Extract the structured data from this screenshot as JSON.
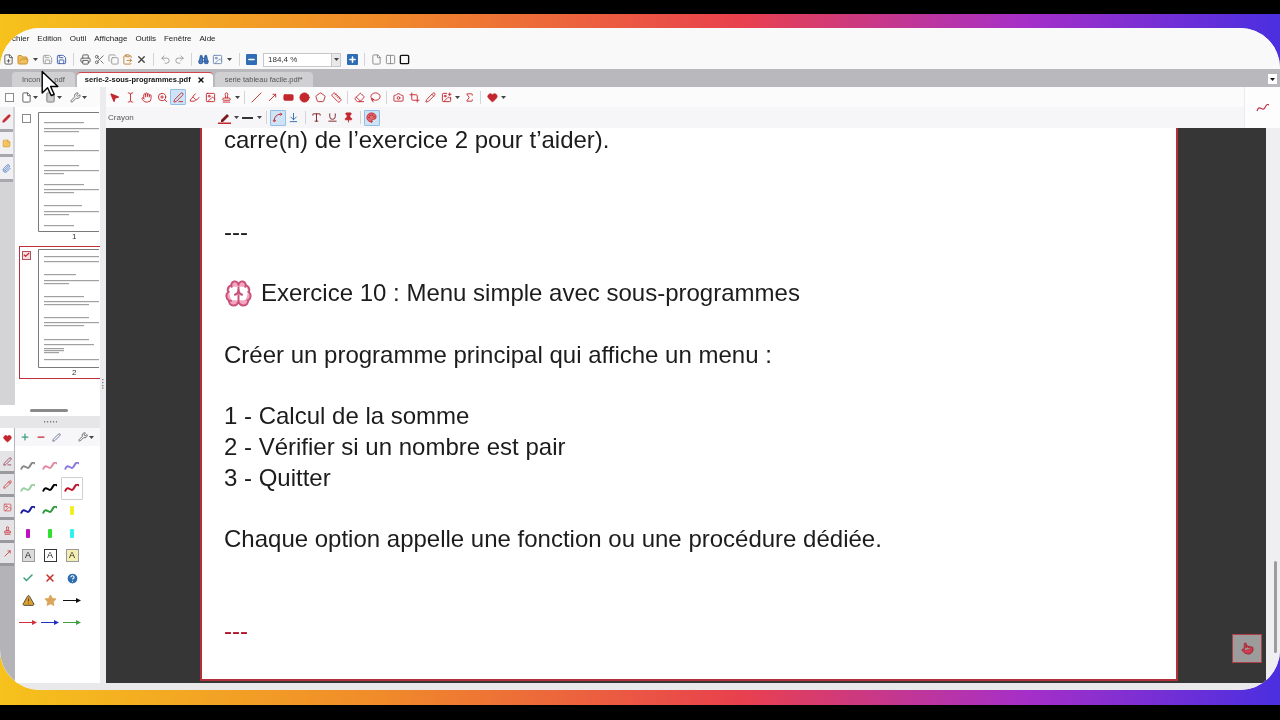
{
  "menu_bar": {
    "items": [
      "chier",
      "Edition",
      "Outil",
      "Affichage",
      "Outils",
      "Fenêtre",
      "Aide"
    ]
  },
  "toolbar": {
    "zoom_field": {
      "value": "184,4 %"
    }
  },
  "tabs": [
    {
      "label": "Incon",
      "label_tail": "pdf",
      "selected": false
    },
    {
      "label": "serie-2-sous-programmes.pdf",
      "selected": true
    },
    {
      "label": "serie tableau facile.pdf*",
      "selected": false
    }
  ],
  "thumbnails_pane": {
    "select_all_checked": false,
    "pages": [
      {
        "label": "1",
        "checked": false,
        "selected": false
      },
      {
        "label": "2",
        "checked": true,
        "selected": true
      }
    ]
  },
  "annotation_toolbar": {
    "tools": [
      {
        "selected": false
      },
      {
        "selected": false
      },
      {
        "selected": false
      },
      {
        "selected": false
      },
      {
        "selected": true
      },
      {
        "selected": false
      },
      {
        "selected": false
      },
      {
        "selected": false
      },
      {
        "selected": false
      },
      {
        "selected": false
      },
      {
        "selected": false
      },
      {
        "selected": false
      },
      {
        "selected": false
      },
      {
        "selected": false
      },
      {
        "selected": false
      },
      {
        "selected": false
      },
      {
        "selected": false
      },
      {
        "selected": false
      },
      {
        "selected": false
      },
      {
        "selected": false
      },
      {
        "selected": false
      },
      {
        "selected": false
      }
    ]
  },
  "property_bar": {
    "label": "Crayon",
    "tools": [
      {
        "selected": false
      },
      {
        "selected": false
      },
      {
        "selected": true
      },
      {
        "selected": false
      },
      {
        "selected": false
      },
      {
        "selected": false
      },
      {
        "selected": false
      },
      {
        "selected": true
      }
    ]
  },
  "comment_styles_pane": {
    "tabs": [
      {
        "selected": true
      },
      {
        "selected": false
      },
      {
        "selected": false
      },
      {
        "selected": false
      },
      {
        "selected": false
      },
      {
        "selected": false
      }
    ],
    "styles": [
      {
        "kind": "squiggle",
        "color": "#8a8a8a",
        "selected": false
      },
      {
        "kind": "squiggle",
        "color": "#e08aa0",
        "selected": false
      },
      {
        "kind": "squiggle",
        "color": "#8a7ae0",
        "selected": false
      },
      {
        "kind": "squiggle",
        "color": "#9ad0a0",
        "selected": false
      },
      {
        "kind": "squiggle",
        "color": "#000000",
        "selected": false
      },
      {
        "kind": "squiggle",
        "color": "#c0102a",
        "selected": true
      },
      {
        "kind": "squiggle",
        "color": "#1a1aa0",
        "selected": false
      },
      {
        "kind": "squiggle",
        "color": "#2a9a3a",
        "selected": false
      },
      {
        "kind": "marker",
        "color": "#f0f020",
        "selected": false
      },
      {
        "kind": "marker",
        "color": "#c010c0",
        "selected": false
      },
      {
        "kind": "marker",
        "color": "#30e030",
        "selected": false
      },
      {
        "kind": "marker",
        "color": "#30f0f0",
        "selected": false
      },
      {
        "kind": "text",
        "label": "A",
        "color": "#dcdcdc",
        "filled": true,
        "selected": false
      },
      {
        "kind": "text",
        "label": "A",
        "color": "#333333",
        "filled": false,
        "selected": false
      },
      {
        "kind": "text",
        "label": "A",
        "color": "#f5eeb0",
        "filled": true,
        "selected": false
      },
      {
        "kind": "check",
        "color": "#3aa07a",
        "selected": false
      },
      {
        "kind": "cross",
        "color": "#c8302a",
        "selected": false
      },
      {
        "kind": "help",
        "color": "#2d6cb0",
        "selected": false
      },
      {
        "kind": "warning",
        "color": "#d9a030",
        "selected": false
      },
      {
        "kind": "star",
        "color": "#dba55a",
        "selected": false
      },
      {
        "kind": "arrow",
        "color": "#111111",
        "selected": false
      },
      {
        "kind": "arrow",
        "color": "#d03040",
        "selected": false
      },
      {
        "kind": "arrow",
        "color": "#2030c0",
        "selected": false
      },
      {
        "kind": "arrow",
        "color": "#40a040",
        "selected": false
      }
    ]
  },
  "document": {
    "blocks": [
      {
        "kind": "paragraph",
        "lines": [
          "carre(n) de l’exercice 2 pour t’aider)."
        ],
        "color": "#1c1c1c"
      },
      {
        "kind": "rule",
        "lines": [
          "---"
        ],
        "color": "#1c1c1c"
      },
      {
        "kind": "heading",
        "lines": [
          "Exercice 10 : Menu simple avec sous-programmes"
        ],
        "color": "#1c1c1c"
      },
      {
        "kind": "paragraph",
        "lines": [
          "Créer un programme principal qui affiche un menu :"
        ],
        "color": "#1c1c1c"
      },
      {
        "kind": "list",
        "lines": [
          "1 - Calcul de la somme",
          "2 - Vérifier si un nombre est pair",
          "3 - Quitter"
        ],
        "color": "#1c1c1c"
      },
      {
        "kind": "paragraph",
        "lines": [
          "Chaque option appelle une fonction ou une procédure dédiée."
        ],
        "color": "#1c1c1c"
      },
      {
        "kind": "rule",
        "lines": [
          "---"
        ],
        "color": "#b3102a"
      }
    ]
  }
}
